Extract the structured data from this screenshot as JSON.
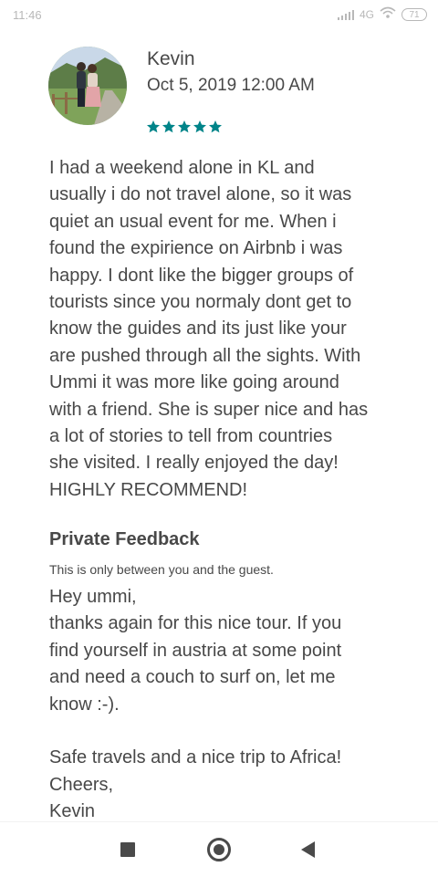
{
  "status_bar": {
    "time": "11:46",
    "network": "4G",
    "battery": "71"
  },
  "review": {
    "reviewer_name": "Kevin",
    "date": "Oct 5, 2019 12:00 AM",
    "rating": 5,
    "star_color": "#008489",
    "text": "I had a weekend alone in KL and\nusually i do not travel alone, so it was\nquiet an usual event for me. When i\nfound the expirience on Airbnb i was\nhappy. I dont like the bigger groups of\ntourists since you normaly dont get to\nknow the guides and its just like your\nare pushed through all the sights. With\nUmmi it was more like going around\nwith a friend. She is super nice and has\na lot of stories to tell from countries\nshe visited. I really enjoyed the day!\nHIGHLY RECOMMEND!"
  },
  "private_feedback": {
    "title": "Private Feedback",
    "subtitle": "This is only between you and the guest.",
    "message": "Hey ummi,\nthanks again for this nice tour. If you\nfind yourself in austria at some point\nand need a couch to surf on, let me\nknow :-).\n\nSafe travels and a nice trip to Africa!\nCheers,\nKevin"
  },
  "navigation": {
    "icons": [
      "recents-icon",
      "home-icon",
      "back-icon"
    ]
  }
}
